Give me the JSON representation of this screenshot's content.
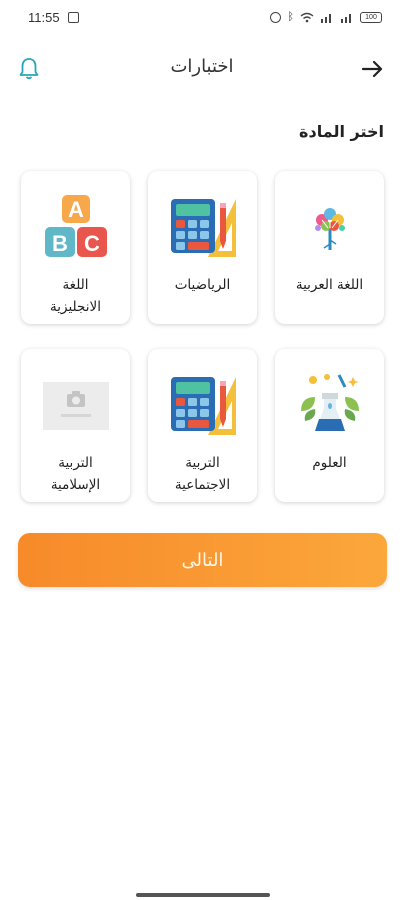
{
  "status_bar": {
    "time": "11:55",
    "signal_text": "⫽",
    "battery": "100"
  },
  "header": {
    "title": "اختبارات"
  },
  "section": {
    "title": "اختر المادة"
  },
  "subjects": [
    {
      "label": "اللغة العربية",
      "icon": "brain-tree-icon"
    },
    {
      "label": "الرياضيات",
      "icon": "calculator-ruler-icon"
    },
    {
      "label": "اللغة\nالانجليزية",
      "icon": "abc-blocks-icon"
    },
    {
      "label": "العلوم",
      "icon": "science-flask-icon"
    },
    {
      "label": "التربية\nالاجتماعية",
      "icon": "calculator-ruler-icon"
    },
    {
      "label": "التربية\nالإسلامية",
      "icon": "image-placeholder-icon"
    }
  ],
  "next_button": {
    "label": "التالى"
  },
  "colors": {
    "accent_orange": "#f78a2a",
    "bell_teal": "#29a7b8"
  }
}
